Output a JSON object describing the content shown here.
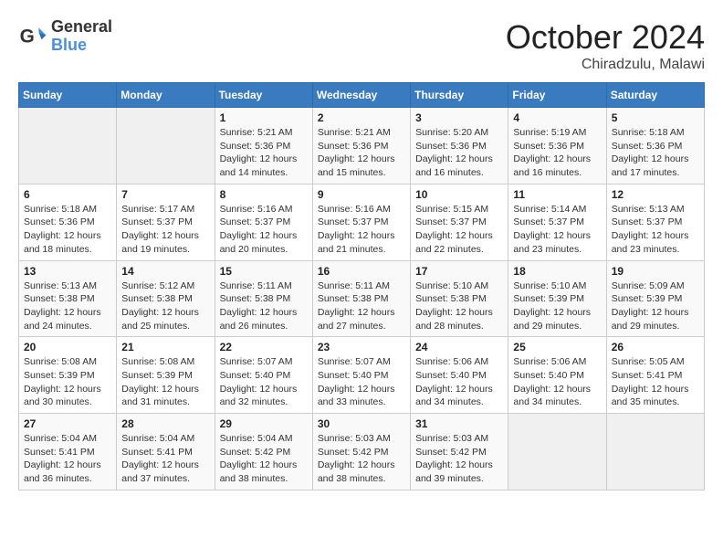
{
  "header": {
    "logo_line1": "General",
    "logo_line2": "Blue",
    "title": "October 2024",
    "subtitle": "Chiradzulu, Malawi"
  },
  "weekdays": [
    "Sunday",
    "Monday",
    "Tuesday",
    "Wednesday",
    "Thursday",
    "Friday",
    "Saturday"
  ],
  "weeks": [
    [
      {
        "day": "",
        "info": ""
      },
      {
        "day": "",
        "info": ""
      },
      {
        "day": "1",
        "info": "Sunrise: 5:21 AM\nSunset: 5:36 PM\nDaylight: 12 hours and 14 minutes."
      },
      {
        "day": "2",
        "info": "Sunrise: 5:21 AM\nSunset: 5:36 PM\nDaylight: 12 hours and 15 minutes."
      },
      {
        "day": "3",
        "info": "Sunrise: 5:20 AM\nSunset: 5:36 PM\nDaylight: 12 hours and 16 minutes."
      },
      {
        "day": "4",
        "info": "Sunrise: 5:19 AM\nSunset: 5:36 PM\nDaylight: 12 hours and 16 minutes."
      },
      {
        "day": "5",
        "info": "Sunrise: 5:18 AM\nSunset: 5:36 PM\nDaylight: 12 hours and 17 minutes."
      }
    ],
    [
      {
        "day": "6",
        "info": "Sunrise: 5:18 AM\nSunset: 5:36 PM\nDaylight: 12 hours and 18 minutes."
      },
      {
        "day": "7",
        "info": "Sunrise: 5:17 AM\nSunset: 5:37 PM\nDaylight: 12 hours and 19 minutes."
      },
      {
        "day": "8",
        "info": "Sunrise: 5:16 AM\nSunset: 5:37 PM\nDaylight: 12 hours and 20 minutes."
      },
      {
        "day": "9",
        "info": "Sunrise: 5:16 AM\nSunset: 5:37 PM\nDaylight: 12 hours and 21 minutes."
      },
      {
        "day": "10",
        "info": "Sunrise: 5:15 AM\nSunset: 5:37 PM\nDaylight: 12 hours and 22 minutes."
      },
      {
        "day": "11",
        "info": "Sunrise: 5:14 AM\nSunset: 5:37 PM\nDaylight: 12 hours and 23 minutes."
      },
      {
        "day": "12",
        "info": "Sunrise: 5:13 AM\nSunset: 5:37 PM\nDaylight: 12 hours and 23 minutes."
      }
    ],
    [
      {
        "day": "13",
        "info": "Sunrise: 5:13 AM\nSunset: 5:38 PM\nDaylight: 12 hours and 24 minutes."
      },
      {
        "day": "14",
        "info": "Sunrise: 5:12 AM\nSunset: 5:38 PM\nDaylight: 12 hours and 25 minutes."
      },
      {
        "day": "15",
        "info": "Sunrise: 5:11 AM\nSunset: 5:38 PM\nDaylight: 12 hours and 26 minutes."
      },
      {
        "day": "16",
        "info": "Sunrise: 5:11 AM\nSunset: 5:38 PM\nDaylight: 12 hours and 27 minutes."
      },
      {
        "day": "17",
        "info": "Sunrise: 5:10 AM\nSunset: 5:38 PM\nDaylight: 12 hours and 28 minutes."
      },
      {
        "day": "18",
        "info": "Sunrise: 5:10 AM\nSunset: 5:39 PM\nDaylight: 12 hours and 29 minutes."
      },
      {
        "day": "19",
        "info": "Sunrise: 5:09 AM\nSunset: 5:39 PM\nDaylight: 12 hours and 29 minutes."
      }
    ],
    [
      {
        "day": "20",
        "info": "Sunrise: 5:08 AM\nSunset: 5:39 PM\nDaylight: 12 hours and 30 minutes."
      },
      {
        "day": "21",
        "info": "Sunrise: 5:08 AM\nSunset: 5:39 PM\nDaylight: 12 hours and 31 minutes."
      },
      {
        "day": "22",
        "info": "Sunrise: 5:07 AM\nSunset: 5:40 PM\nDaylight: 12 hours and 32 minutes."
      },
      {
        "day": "23",
        "info": "Sunrise: 5:07 AM\nSunset: 5:40 PM\nDaylight: 12 hours and 33 minutes."
      },
      {
        "day": "24",
        "info": "Sunrise: 5:06 AM\nSunset: 5:40 PM\nDaylight: 12 hours and 34 minutes."
      },
      {
        "day": "25",
        "info": "Sunrise: 5:06 AM\nSunset: 5:40 PM\nDaylight: 12 hours and 34 minutes."
      },
      {
        "day": "26",
        "info": "Sunrise: 5:05 AM\nSunset: 5:41 PM\nDaylight: 12 hours and 35 minutes."
      }
    ],
    [
      {
        "day": "27",
        "info": "Sunrise: 5:04 AM\nSunset: 5:41 PM\nDaylight: 12 hours and 36 minutes."
      },
      {
        "day": "28",
        "info": "Sunrise: 5:04 AM\nSunset: 5:41 PM\nDaylight: 12 hours and 37 minutes."
      },
      {
        "day": "29",
        "info": "Sunrise: 5:04 AM\nSunset: 5:42 PM\nDaylight: 12 hours and 38 minutes."
      },
      {
        "day": "30",
        "info": "Sunrise: 5:03 AM\nSunset: 5:42 PM\nDaylight: 12 hours and 38 minutes."
      },
      {
        "day": "31",
        "info": "Sunrise: 5:03 AM\nSunset: 5:42 PM\nDaylight: 12 hours and 39 minutes."
      },
      {
        "day": "",
        "info": ""
      },
      {
        "day": "",
        "info": ""
      }
    ]
  ]
}
